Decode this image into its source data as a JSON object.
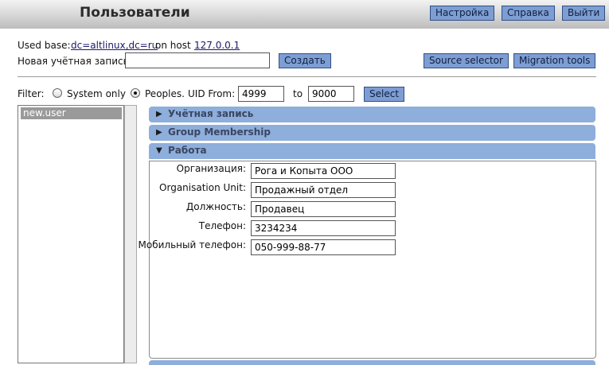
{
  "header": {
    "title": "Пользователи",
    "buttons": {
      "settings": "Настройка",
      "help": "Справка",
      "logout": "Выйти"
    }
  },
  "connection": {
    "used_base_label": "Used base:",
    "base_dn": "dc=altlinux,dc=ru",
    "on_host_label": "on host",
    "host": "127.0.0.1"
  },
  "new_account": {
    "label": "Новая учётная запись:",
    "value": "",
    "create_button": "Создать"
  },
  "tools": {
    "source_selector": "Source selector",
    "migration_tools": "Migration tools"
  },
  "filter": {
    "label": "Filter:",
    "system_only": "System only",
    "peoples": "Peoples.",
    "selected": "Peoples.",
    "uid_from_label": "UID From:",
    "uid_from": "4999",
    "to_label": "to",
    "uid_to": "9000",
    "select_button": "Select"
  },
  "users": [
    "new.user"
  ],
  "sections": [
    {
      "label": "Учётная запись",
      "expanded": false
    },
    {
      "label": "Group Membership",
      "expanded": false
    },
    {
      "label": "Работа",
      "expanded": true
    }
  ],
  "work_form": {
    "organization_label": "Организация:",
    "organization": "Рога и Копыта ООО",
    "unit_label": "Organisation Unit:",
    "unit": "Продажный отдел",
    "position_label": "Должность:",
    "position": "Продавец",
    "phone_label": "Телефон:",
    "phone": "3234234",
    "mobile_label": "Мобильный телефон:",
    "mobile": "050-999-88-77"
  },
  "colors": {
    "button_bg": "#7e9ed3",
    "accordion_bg": "#8eaedc",
    "selected_item": "#9a9a9a"
  }
}
